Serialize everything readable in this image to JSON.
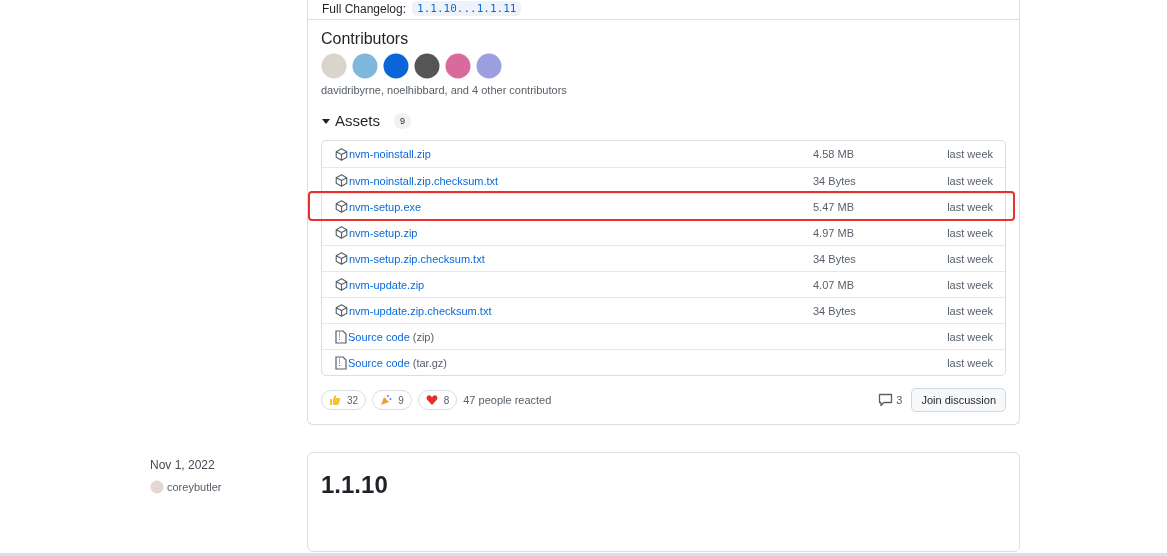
{
  "release_card": {
    "changelog_label": "Full Changelog:",
    "changelog_link": "1.1.10...1.1.11",
    "contributors": {
      "title": "Contributors",
      "avatars": [
        {
          "color": "#d9d4cc"
        },
        {
          "color": "#7fb8dd"
        },
        {
          "color": "#0a66d8"
        },
        {
          "color": "#555555"
        },
        {
          "color": "#d86a9c"
        },
        {
          "color": "#9c9fe0"
        }
      ],
      "summary": "davidribyrne, noelhibbard, and 4 other contributors"
    },
    "assets": {
      "title": "Assets",
      "expanded": true,
      "count": "9",
      "rows": [
        {
          "kind": "package",
          "name": "nvm-noinstall.zip",
          "size": "4.58 MB",
          "date": "last week",
          "highlighted": false
        },
        {
          "kind": "package",
          "name": "nvm-noinstall.zip.checksum.txt",
          "size": "34 Bytes",
          "date": "last week",
          "highlighted": false
        },
        {
          "kind": "package",
          "name": "nvm-setup.exe",
          "size": "5.47 MB",
          "date": "last week",
          "highlighted": true
        },
        {
          "kind": "package",
          "name": "nvm-setup.zip",
          "size": "4.97 MB",
          "date": "last week",
          "highlighted": false
        },
        {
          "kind": "package",
          "name": "nvm-setup.zip.checksum.txt",
          "size": "34 Bytes",
          "date": "last week",
          "highlighted": false
        },
        {
          "kind": "package",
          "name": "nvm-update.zip",
          "size": "4.07 MB",
          "date": "last week",
          "highlighted": false
        },
        {
          "kind": "package",
          "name": "nvm-update.zip.checksum.txt",
          "size": "34 Bytes",
          "date": "last week",
          "highlighted": false
        },
        {
          "kind": "source",
          "name": "Source code",
          "format": "(zip)",
          "date": "last week",
          "highlighted": false
        },
        {
          "kind": "source",
          "name": "Source code",
          "format": "(tar.gz)",
          "date": "last week",
          "highlighted": false
        }
      ]
    },
    "reactions": [
      {
        "kind": "thumbs",
        "count": "32"
      },
      {
        "kind": "party",
        "count": "9"
      },
      {
        "kind": "heart",
        "count": "8"
      }
    ],
    "reacted_text": "47 people reacted",
    "comment_count": "3",
    "join_button": "Join discussion"
  },
  "next_release": {
    "date": "Nov 1, 2022",
    "author": "coreybutler",
    "version": "1.1.10"
  }
}
